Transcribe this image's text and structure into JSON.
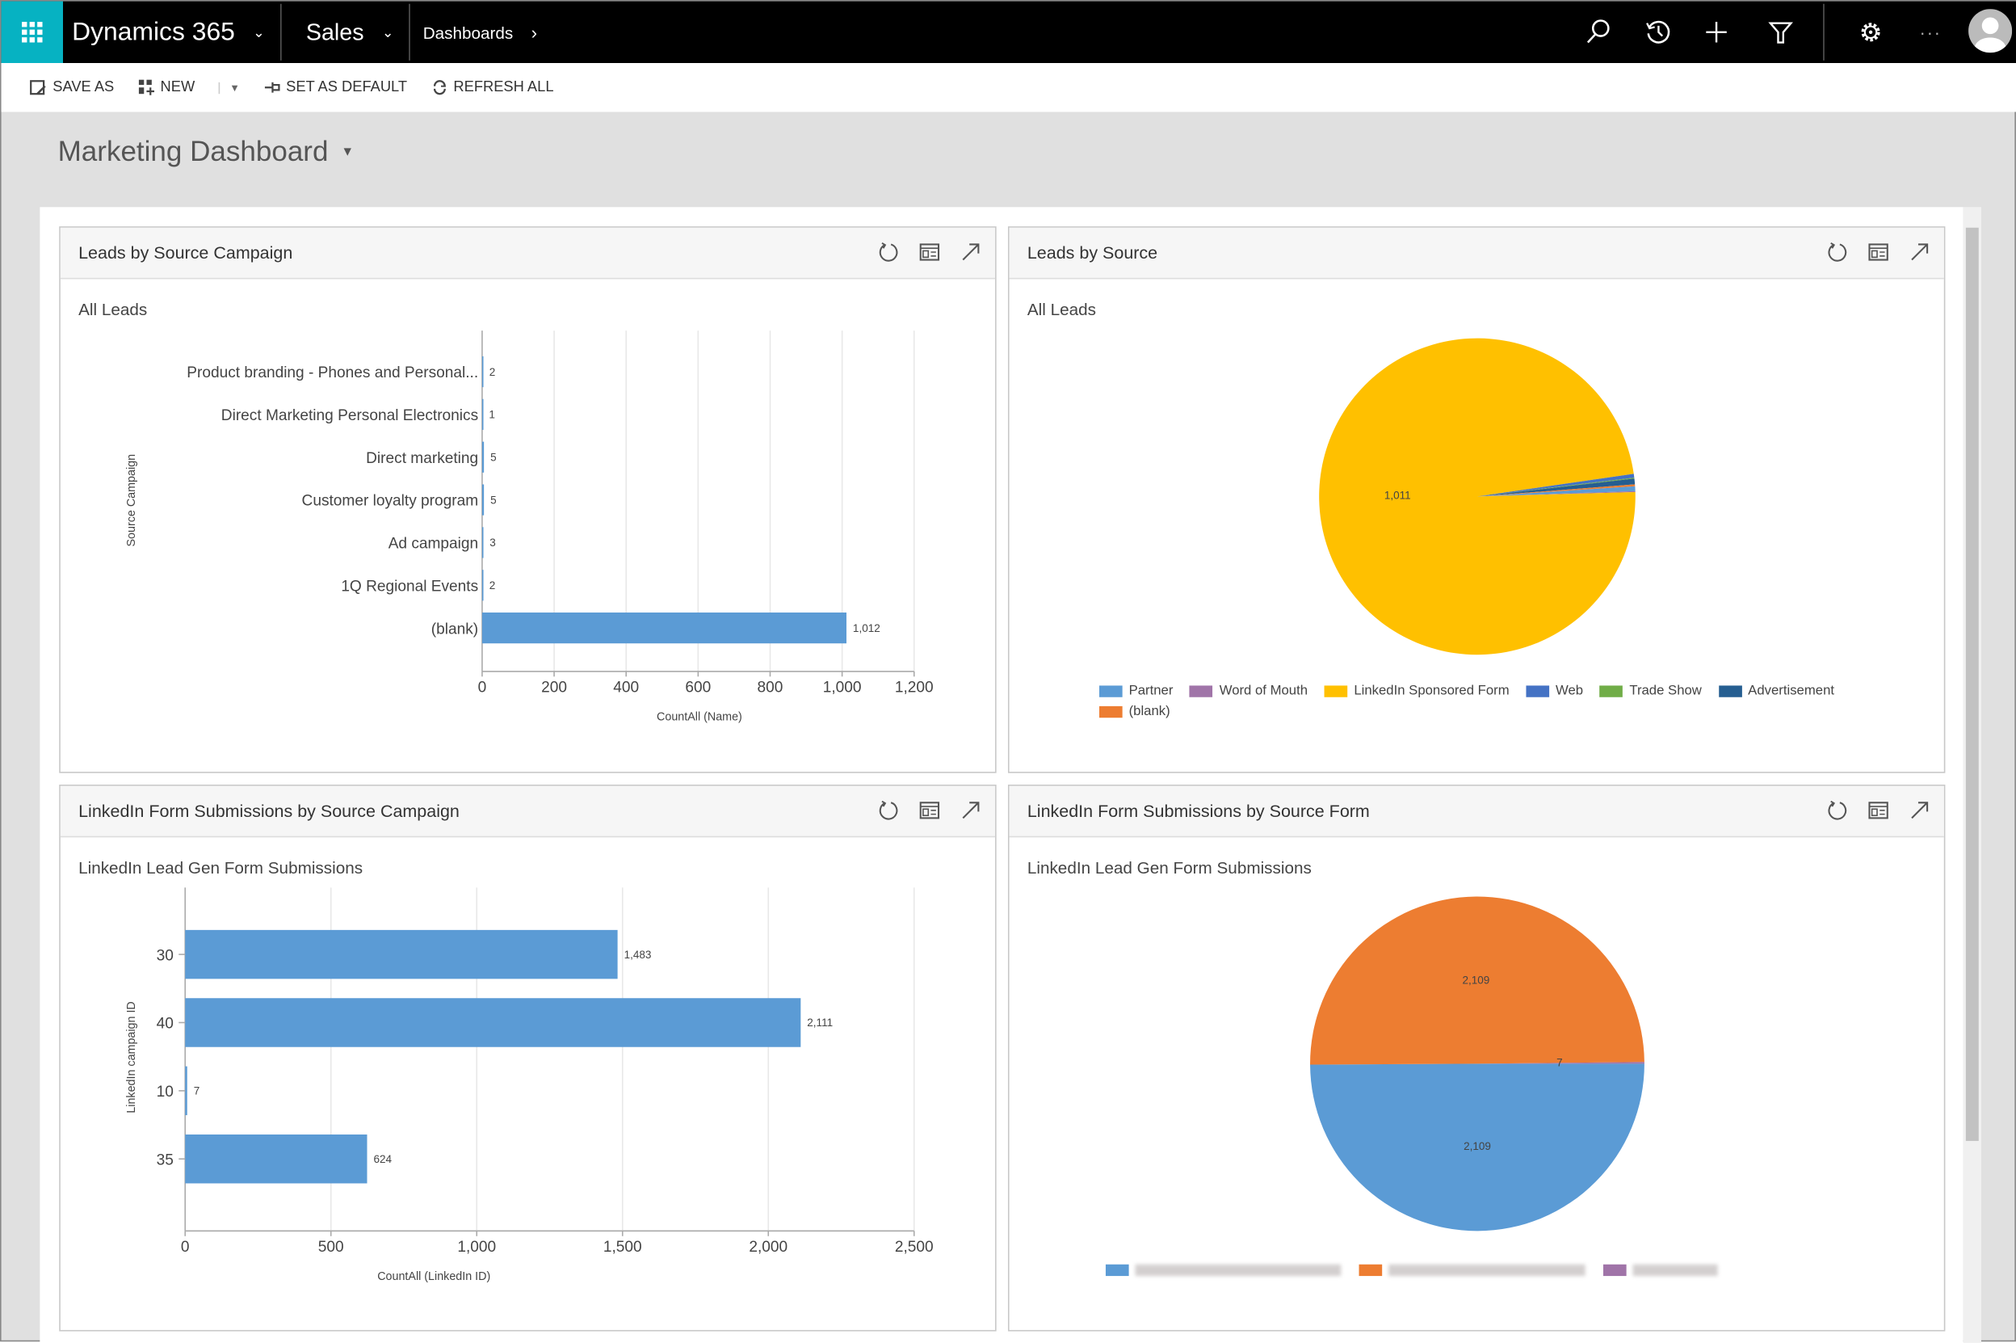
{
  "topbar": {
    "app_name": "Dynamics 365",
    "module": "Sales",
    "breadcrumb": "Dashboards",
    "icons": [
      "waffle-icon",
      "search-icon",
      "history-icon",
      "plus-icon",
      "filter-icon",
      "gear-icon",
      "more-icon",
      "avatar-icon"
    ],
    "accent_color": "#06b2c2"
  },
  "commandbar": {
    "save_as": "SAVE AS",
    "new": "NEW",
    "set_as_default": "SET AS DEFAULT",
    "refresh_all": "REFRESH ALL"
  },
  "dashboard": {
    "title": "Marketing Dashboard"
  },
  "cards": [
    {
      "title": "Leads by Source Campaign",
      "view": "All Leads"
    },
    {
      "title": "Leads by Source",
      "view": "All Leads"
    },
    {
      "title": "LinkedIn Form Submissions by Source Campaign",
      "view": "LinkedIn Lead Gen Form Submissions"
    },
    {
      "title": "LinkedIn Form Submissions by Source Form",
      "view": "LinkedIn Lead Gen Form Submissions"
    }
  ],
  "chart_data": [
    {
      "type": "bar",
      "orientation": "horizontal",
      "categories": [
        "Product branding - Phones and Personal...",
        "Direct Marketing Personal Electronics",
        "Direct marketing",
        "Customer loyalty program",
        "Ad campaign",
        "1Q Regional Events",
        "(blank)"
      ],
      "values": [
        2,
        1,
        5,
        5,
        3,
        2,
        1012
      ],
      "value_labels": [
        "2",
        "1",
        "5",
        "5",
        "3",
        "2",
        "1,012"
      ],
      "xlabel": "CountAll (Name)",
      "ylabel": "Source Campaign",
      "xlim": [
        0,
        1200
      ],
      "xticks": [
        0,
        200,
        400,
        600,
        800,
        1000,
        1200
      ],
      "xtick_labels": [
        "0",
        "200",
        "400",
        "600",
        "800",
        "1,000",
        "1,200"
      ],
      "grid": true,
      "color": "#5b9bd5"
    },
    {
      "type": "pie",
      "labels": [
        "Partner",
        "Word of Mouth",
        "LinkedIn Sponsored Form",
        "Web",
        "Trade Show",
        "Advertisement",
        "(blank)"
      ],
      "values": [
        5,
        1,
        1011,
        4,
        1,
        6,
        2
      ],
      "colors": [
        "#5b9bd5",
        "#a074a8",
        "#ffc000",
        "#4472c4",
        "#70ad47",
        "#255e91",
        "#ed7d31"
      ],
      "data_label": "1,011",
      "legend": "bottom"
    },
    {
      "type": "bar",
      "orientation": "horizontal",
      "categories": [
        "30",
        "40",
        "10",
        "35"
      ],
      "values": [
        1483,
        2111,
        7,
        624
      ],
      "value_labels": [
        "1,483",
        "2,111",
        "7",
        "624"
      ],
      "xlabel": "CountAll (LinkedIn ID)",
      "ylabel": "LinkedIn campaign ID",
      "xlim": [
        0,
        2500
      ],
      "xticks": [
        0,
        500,
        1000,
        1500,
        2000,
        2500
      ],
      "xtick_labels": [
        "0",
        "500",
        "1,000",
        "1,500",
        "2,000",
        "2,500"
      ],
      "grid": true,
      "color": "#5b9bd5"
    },
    {
      "type": "pie",
      "values": [
        2109,
        2109,
        7
      ],
      "value_labels": [
        "2,109",
        "2,109",
        "7"
      ],
      "colors": [
        "#5b9bd5",
        "#ed7d31",
        "#a074a8"
      ],
      "legend": "bottom"
    }
  ]
}
